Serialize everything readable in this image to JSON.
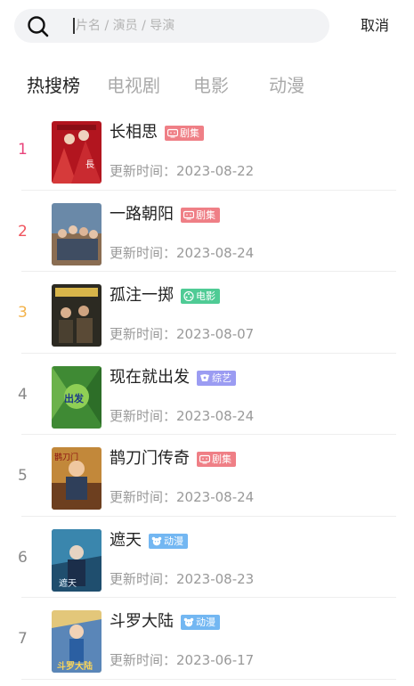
{
  "search": {
    "placeholder": "片名 / 演员 / 导演",
    "cancel_label": "取消"
  },
  "tabs": [
    {
      "label": "热搜榜",
      "active": true
    },
    {
      "label": "电视剧",
      "active": false
    },
    {
      "label": "电影",
      "active": false
    },
    {
      "label": "动漫",
      "active": false
    }
  ],
  "colors": {
    "rank_top1": "#e8437a",
    "rank_top2": "#f0545e",
    "rank_top3": "#f3b24a",
    "rank_other": "#888888",
    "badge_tv": "#ef7f86",
    "badge_movie": "#4fcb95",
    "badge_variety": "#9b9cf2",
    "badge_anime": "#73b7f2"
  },
  "update_prefix": "更新时间：",
  "items": [
    {
      "rank": "1",
      "title": "长相思",
      "badge": "剧集",
      "badge_type": "tv",
      "badge_icon": "tv-icon",
      "updated": "2023-08-22"
    },
    {
      "rank": "2",
      "title": "一路朝阳",
      "badge": "剧集",
      "badge_type": "tv",
      "badge_icon": "tv-icon",
      "updated": "2023-08-24"
    },
    {
      "rank": "3",
      "title": "孤注一掷",
      "badge": "电影",
      "badge_type": "movie",
      "badge_icon": "film-reel-icon",
      "updated": "2023-08-07"
    },
    {
      "rank": "4",
      "title": "现在就出发",
      "badge": "综艺",
      "badge_type": "variety",
      "badge_icon": "variety-icon",
      "updated": "2023-08-24"
    },
    {
      "rank": "5",
      "title": "鹊刀门传奇",
      "badge": "剧集",
      "badge_type": "tv",
      "badge_icon": "tv-icon",
      "updated": "2023-08-24"
    },
    {
      "rank": "6",
      "title": "遮天",
      "badge": "动漫",
      "badge_type": "anime",
      "badge_icon": "anime-bear-icon",
      "updated": "2023-08-23"
    },
    {
      "rank": "7",
      "title": "斗罗大陆",
      "badge": "动漫",
      "badge_type": "anime",
      "badge_icon": "anime-bear-icon",
      "updated": "2023-06-17"
    }
  ]
}
